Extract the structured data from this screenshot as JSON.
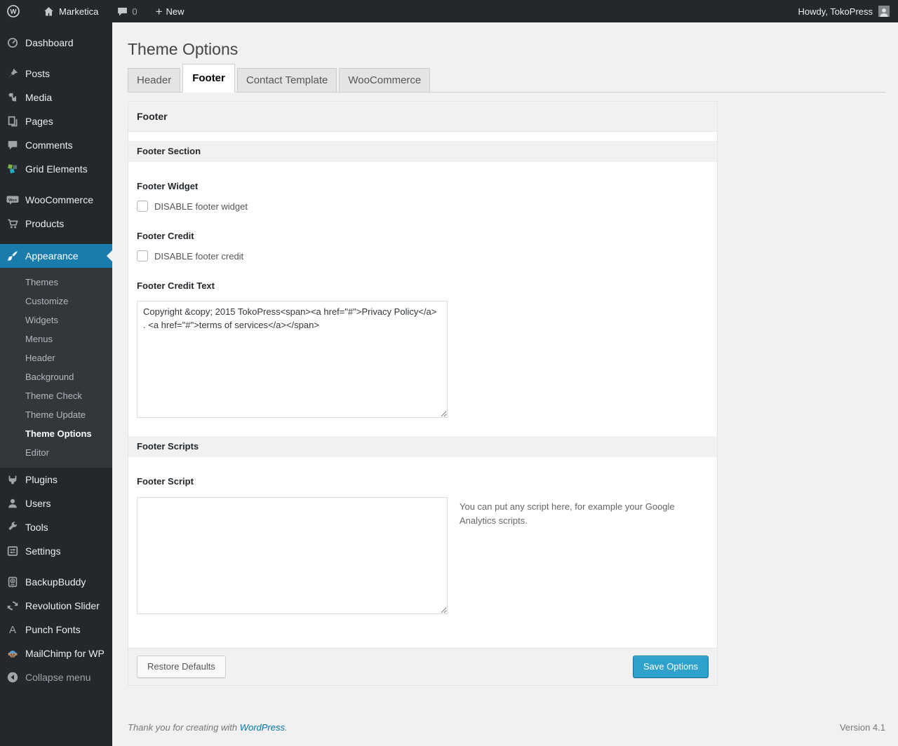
{
  "admin_bar": {
    "site_name": "Marketica",
    "comments_count": "0",
    "new_label": "New",
    "howdy": "Howdy, TokoPress"
  },
  "sidebar": {
    "menu": [
      "Dashboard",
      "Posts",
      "Media",
      "Pages",
      "Comments",
      "Grid Elements",
      "WooCommerce",
      "Products",
      "Appearance",
      "Plugins",
      "Users",
      "Tools",
      "Settings",
      "BackupBuddy",
      "Revolution Slider",
      "Punch Fonts",
      "MailChimp for WP",
      "Collapse menu"
    ],
    "appearance_submenu": [
      "Themes",
      "Customize",
      "Widgets",
      "Menus",
      "Header",
      "Background",
      "Theme Check",
      "Theme Update",
      "Theme Options",
      "Editor"
    ],
    "current_item": "Appearance",
    "current_subitem": "Theme Options"
  },
  "page": {
    "title": "Theme Options",
    "tabs": [
      "Header",
      "Footer",
      "Contact Template",
      "WooCommerce"
    ],
    "active_tab": "Footer",
    "panel": {
      "header": "Footer",
      "section1_title": "Footer Section",
      "footer_widget_label": "Footer Widget",
      "footer_widget_checkbox": "DISABLE footer widget",
      "footer_credit_label": "Footer Credit",
      "footer_credit_checkbox": "DISABLE footer credit",
      "footer_credit_text_label": "Footer Credit Text",
      "footer_credit_text_value": "Copyright &copy; 2015 TokoPress<span><a href=\"#\">Privacy Policy</a> . <a href=\"#\">terms of services</a></span>",
      "section2_title": "Footer Scripts",
      "footer_script_label": "Footer Script",
      "footer_script_value": "",
      "footer_script_help": "You can put any script here, for example your Google Analytics scripts.",
      "restore_button": "Restore Defaults",
      "save_button": "Save Options"
    },
    "footer": {
      "thanks_prefix": "Thank you for creating with ",
      "wordpress_link": "WordPress",
      "thanks_suffix": ".",
      "version": "Version 4.1"
    }
  },
  "colors": {
    "admin_dark": "#23282d",
    "menu_current_blue": "#1a7cad",
    "primary_button": "#2ea2cc",
    "link_blue": "#0073aa",
    "page_background": "#f1f1f1"
  }
}
